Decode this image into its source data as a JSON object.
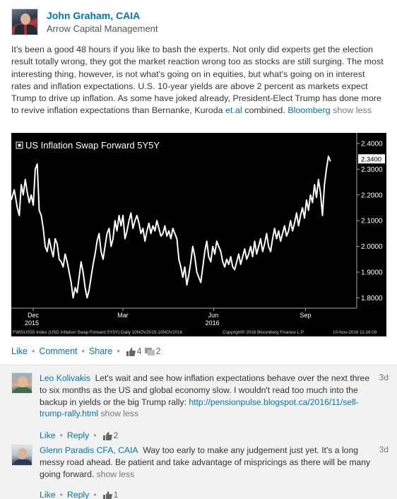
{
  "author": {
    "name": "John Graham, CAIA",
    "company": "Arrow Capital Management"
  },
  "post": {
    "text": "It's been a good 48 hours if you like to bash the experts. Not only did experts get the election result totally wrong, they got the market reaction wrong too as stocks are still surging. The most interesting thing, however, is not what's going on in equities, but what's going on in interest rates and inflation expectations. U.S. 10-year yields are above 2 percent as markets expect Trump to drive up inflation. As some have joked already, President-Elect Trump has done more to revive inflation expectations than Bernanke, Kuroda ",
    "link_etal": "et.al",
    "text_after": " combined. ",
    "link_source": "Bloomberg",
    "show_less": "show less"
  },
  "chart_data": {
    "type": "line",
    "title": "US Inflation Swap Forward 5Y5Y",
    "last_value_label": "2.3400",
    "y_ticks": [
      "2.4000",
      "2.3000",
      "2.2000",
      "2.1000",
      "2.0000",
      "1.9000",
      "1.8000"
    ],
    "ylim": [
      1.76,
      2.43
    ],
    "x_ticks": [
      {
        "label": "Dec",
        "sub": "2015",
        "x": 22
      },
      {
        "label": "Mar",
        "sub": "",
        "x": 112
      },
      {
        "label": "Jun",
        "sub": "2016",
        "x": 203
      },
      {
        "label": "Sep",
        "sub": "",
        "x": 295
      }
    ],
    "xlim": [
      0,
      340
    ],
    "footer_left": "FWISUS55 Index (USD Inflation Swap Forward 5Y5Y) Daily 10NOV2015-10NOV2016",
    "footer_mid": "Copyright® 2016 Bloomberg Finance L.P.",
    "footer_right": "10-Nov-2016 11:16:09",
    "series": [
      {
        "values_x": [
          0,
          3,
          6,
          8,
          10,
          12,
          14,
          16,
          18,
          20,
          22,
          24,
          26,
          28,
          30,
          32,
          34,
          36,
          38,
          40,
          42,
          44,
          46,
          48,
          50,
          52,
          54,
          56,
          58,
          60,
          62,
          64,
          66,
          68,
          70,
          72,
          74,
          76,
          78,
          80,
          82,
          84,
          86,
          88,
          90,
          92,
          94,
          96,
          98,
          100,
          102,
          104,
          106,
          108,
          110,
          112,
          114,
          116,
          118,
          120,
          122,
          124,
          126,
          128,
          130,
          132,
          134,
          136,
          138,
          140,
          142,
          144,
          146,
          148,
          150,
          152,
          154,
          156,
          158,
          160,
          162,
          164,
          166,
          168,
          170,
          172,
          174,
          176,
          178,
          180,
          182,
          184,
          186,
          188,
          190,
          192,
          194,
          196,
          198,
          200,
          202,
          204,
          206,
          208,
          210,
          212,
          214,
          216,
          218,
          220,
          222,
          224,
          226,
          228,
          230,
          232,
          234,
          236,
          238,
          240,
          242,
          244,
          246,
          248,
          250,
          252,
          254,
          256,
          258,
          260,
          262,
          264,
          266,
          268,
          270,
          272,
          274,
          276,
          278,
          280,
          282,
          284,
          286,
          288,
          290,
          292,
          294,
          296,
          298,
          300,
          302,
          304,
          306,
          308,
          310,
          312,
          314,
          316,
          318,
          320,
          322,
          324,
          326,
          328,
          330,
          332,
          334,
          336,
          338,
          340
        ],
        "values_y": [
          2.18,
          2.22,
          2.15,
          2.12,
          2.24,
          2.2,
          2.26,
          2.21,
          2.17,
          2.2,
          2.16,
          2.3,
          2.32,
          2.14,
          2.12,
          2.07,
          2.0,
          1.98,
          2.03,
          1.99,
          1.96,
          2.03,
          2.01,
          1.95,
          1.94,
          1.92,
          1.97,
          1.94,
          1.9,
          1.86,
          1.8,
          1.84,
          1.82,
          1.88,
          1.94,
          1.9,
          1.84,
          1.8,
          1.83,
          1.88,
          1.93,
          1.97,
          2.02,
          2.05,
          1.98,
          1.95,
          2.0,
          2.05,
          2.07,
          2.0,
          2.03,
          2.1,
          2.06,
          2.12,
          2.08,
          2.12,
          2.03,
          2.06,
          2.1,
          2.13,
          2.07,
          2.1,
          2.12,
          2.09,
          2.05,
          2.07,
          2.02,
          2.06,
          2.09,
          2.05,
          2.08,
          2.06,
          2.1,
          2.07,
          2.04,
          2.05,
          2.08,
          2.04,
          2.06,
          2.03,
          2.07,
          2.05,
          2.03,
          1.95,
          1.92,
          1.88,
          1.92,
          1.85,
          1.89,
          1.94,
          2.0,
          1.96,
          1.9,
          1.88,
          1.86,
          1.92,
          1.98,
          2.02,
          1.96,
          1.94,
          2.0,
          1.97,
          2.02,
          2.0,
          1.98,
          1.94,
          1.92,
          1.95,
          1.93,
          1.96,
          1.92,
          1.91,
          1.94,
          1.97,
          1.93,
          1.96,
          1.99,
          1.95,
          1.97,
          2.0,
          1.96,
          2.02,
          1.97,
          2.0,
          2.03,
          1.98,
          2.01,
          2.05,
          2.0,
          1.98,
          2.03,
          2.07,
          2.03,
          2.06,
          2.02,
          2.05,
          2.08,
          2.04,
          2.06,
          2.1,
          2.06,
          2.09,
          2.13,
          2.08,
          2.12,
          2.15,
          2.11,
          2.18,
          2.14,
          2.2,
          2.17,
          2.24,
          2.19,
          2.26,
          2.21,
          2.12,
          2.24,
          2.3,
          2.35,
          2.33
        ]
      }
    ]
  },
  "post_actions": {
    "like": "Like",
    "comment": "Comment",
    "share": "Share",
    "likes_count": "4",
    "comments_count": "2"
  },
  "comments": [
    {
      "name": "Leo Kolivakis",
      "text": "Let's wait and see how inflation expectations behave over the next three to six months as the US and global economy slow. I wouldn't read too much into the backup in yields or the big Trump rally: ",
      "link": "http://pensionpulse.blogspot.ca/2016/11/sell-trump-rally.html",
      "show_less": "show less",
      "date": "3d",
      "like": "Like",
      "reply": "Reply",
      "likes": "2"
    },
    {
      "name": "Glenn Paradis CFA, CAIA",
      "text": "Way too early to make any judgement just yet. It's a long messy road ahead. Be patient and take advantage of mispricings as there will be many going forward.",
      "show_less": "show less",
      "date": "3d",
      "like": "Like",
      "reply": "Reply",
      "likes": "1"
    }
  ]
}
